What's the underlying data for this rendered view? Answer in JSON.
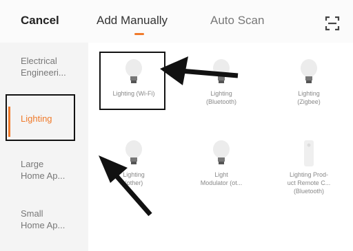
{
  "header": {
    "cancel_label": "Cancel",
    "tabs": [
      {
        "label": "Add Manually",
        "active": true
      },
      {
        "label": "Auto Scan",
        "active": false
      }
    ],
    "scan_icon": "scan-icon"
  },
  "sidebar": {
    "items": [
      {
        "line1": "Electrical",
        "line2": "Engineeri..."
      },
      {
        "line1": "Lighting",
        "line2": ""
      },
      {
        "line1": "Large",
        "line2": "Home Ap..."
      },
      {
        "line1": "Small",
        "line2": "Home Ap..."
      }
    ]
  },
  "devices": [
    {
      "line1": "Lighting (Wi-Fi)",
      "line2": ""
    },
    {
      "line1": "Lighting",
      "line2": "(Bluetooth)"
    },
    {
      "line1": "Lighting",
      "line2": "(Zigbee)"
    },
    {
      "line1": "Lighting",
      "line2": "(other)"
    },
    {
      "line1": "Light",
      "line2": "Modulator (ot..."
    },
    {
      "line1": "Lighting Prod-",
      "line2": "uct Remote C...",
      "line3": "(Bluetooth)"
    }
  ],
  "colors": {
    "accent": "#f07a2a",
    "annotation": "#111111"
  }
}
